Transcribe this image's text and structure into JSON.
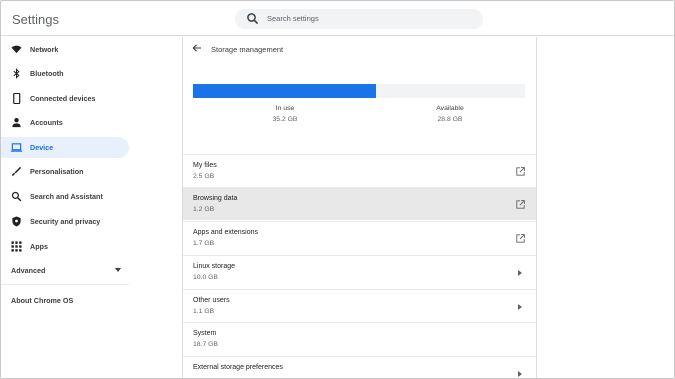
{
  "header": {
    "title": "Settings",
    "search_placeholder": "Search settings"
  },
  "sidebar": {
    "items": [
      {
        "label": "Network",
        "icon": "wifi-icon"
      },
      {
        "label": "Bluetooth",
        "icon": "bluetooth-icon"
      },
      {
        "label": "Connected devices",
        "icon": "phone-icon"
      },
      {
        "label": "Accounts",
        "icon": "person-icon"
      },
      {
        "label": "Device",
        "icon": "laptop-icon",
        "active": true
      },
      {
        "label": "Personalisation",
        "icon": "brush-icon"
      },
      {
        "label": "Search and Assistant",
        "icon": "search-icon"
      },
      {
        "label": "Security and privacy",
        "icon": "shield-icon"
      },
      {
        "label": "Apps",
        "icon": "apps-grid-icon"
      }
    ],
    "advanced_label": "Advanced",
    "about_label": "About Chrome OS"
  },
  "main": {
    "title": "Storage management",
    "usage": {
      "in_use_fraction": 0.55,
      "in_use_label": "In use",
      "in_use_value": "35.2 GB",
      "available_label": "Available",
      "available_value": "28.8 GB"
    },
    "rows": [
      {
        "title": "My files",
        "subtitle": "2.5 GB",
        "action": "external-link-icon"
      },
      {
        "title": "Browsing data",
        "subtitle": "1.2 GB",
        "action": "external-link-icon",
        "highlighted": true
      },
      {
        "title": "Apps and extensions",
        "subtitle": "1.7 GB",
        "action": "external-link-icon"
      },
      {
        "title": "Linux storage",
        "subtitle": "10.0 GB",
        "action": "chevron-right-icon"
      },
      {
        "title": "Other users",
        "subtitle": "1.1 GB",
        "action": "chevron-right-icon"
      },
      {
        "title": "System",
        "subtitle": "18.7 GB",
        "action": ""
      },
      {
        "title": "External storage preferences",
        "subtitle": "",
        "action": "chevron-right-icon"
      }
    ]
  },
  "colors": {
    "accent": "#1a73e8",
    "active_bg": "#e8f0fe",
    "highlight_row": "#e8e8e8"
  }
}
